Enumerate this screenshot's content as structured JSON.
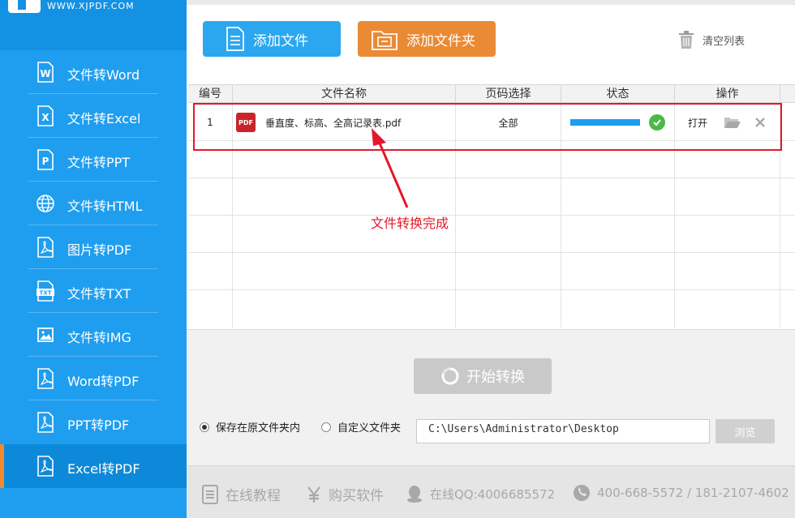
{
  "logo": {
    "text": "WWW.XJPDF.COM"
  },
  "sidebar": {
    "items": [
      {
        "label": "文件转Word",
        "icon": "word-file-icon"
      },
      {
        "label": "文件转Excel",
        "icon": "excel-file-icon"
      },
      {
        "label": "文件转PPT",
        "icon": "ppt-file-icon"
      },
      {
        "label": "文件转HTML",
        "icon": "globe-icon"
      },
      {
        "label": "图片转PDF",
        "icon": "pdf-file-icon"
      },
      {
        "label": "文件转TXT",
        "icon": "txt-file-icon"
      },
      {
        "label": "文件转IMG",
        "icon": "image-icon"
      },
      {
        "label": "Word转PDF",
        "icon": "pdf-file-icon"
      },
      {
        "label": "PPT转PDF",
        "icon": "pdf-file-icon"
      },
      {
        "label": "Excel转PDF",
        "icon": "pdf-file-icon"
      }
    ],
    "active_index": 9
  },
  "toolbar": {
    "add_file": "添加文件",
    "add_folder": "添加文件夹",
    "clear_list": "清空列表"
  },
  "table": {
    "headers": [
      "编号",
      "文件名称",
      "页码选择",
      "状态",
      "操作"
    ],
    "rows": [
      {
        "index": "1",
        "file_badge": "PDF",
        "file_name": "垂直度、标高、全高记录表.pdf",
        "pages": "全部",
        "progress": 1.0,
        "open_label": "打开"
      }
    ]
  },
  "annotation": {
    "text": "文件转换完成",
    "color": "#e3182a"
  },
  "convert": {
    "start_label": "开始转换"
  },
  "output": {
    "option_original": "保存在原文件夹内",
    "option_custom": "自定义文件夹",
    "selected": "original",
    "path": "C:\\Users\\Administrator\\Desktop",
    "browse_label": "浏览"
  },
  "footer": {
    "tutorial": "在线教程",
    "buy": "购买软件",
    "qq": "在线QQ:4006685572",
    "phone": "400-668-5572 / 181-2107-4602"
  },
  "colors": {
    "sidebar": "#1f9eef",
    "accent_blue": "#2ba7f0",
    "accent_orange": "#ea8a35",
    "success": "#4cb848"
  }
}
